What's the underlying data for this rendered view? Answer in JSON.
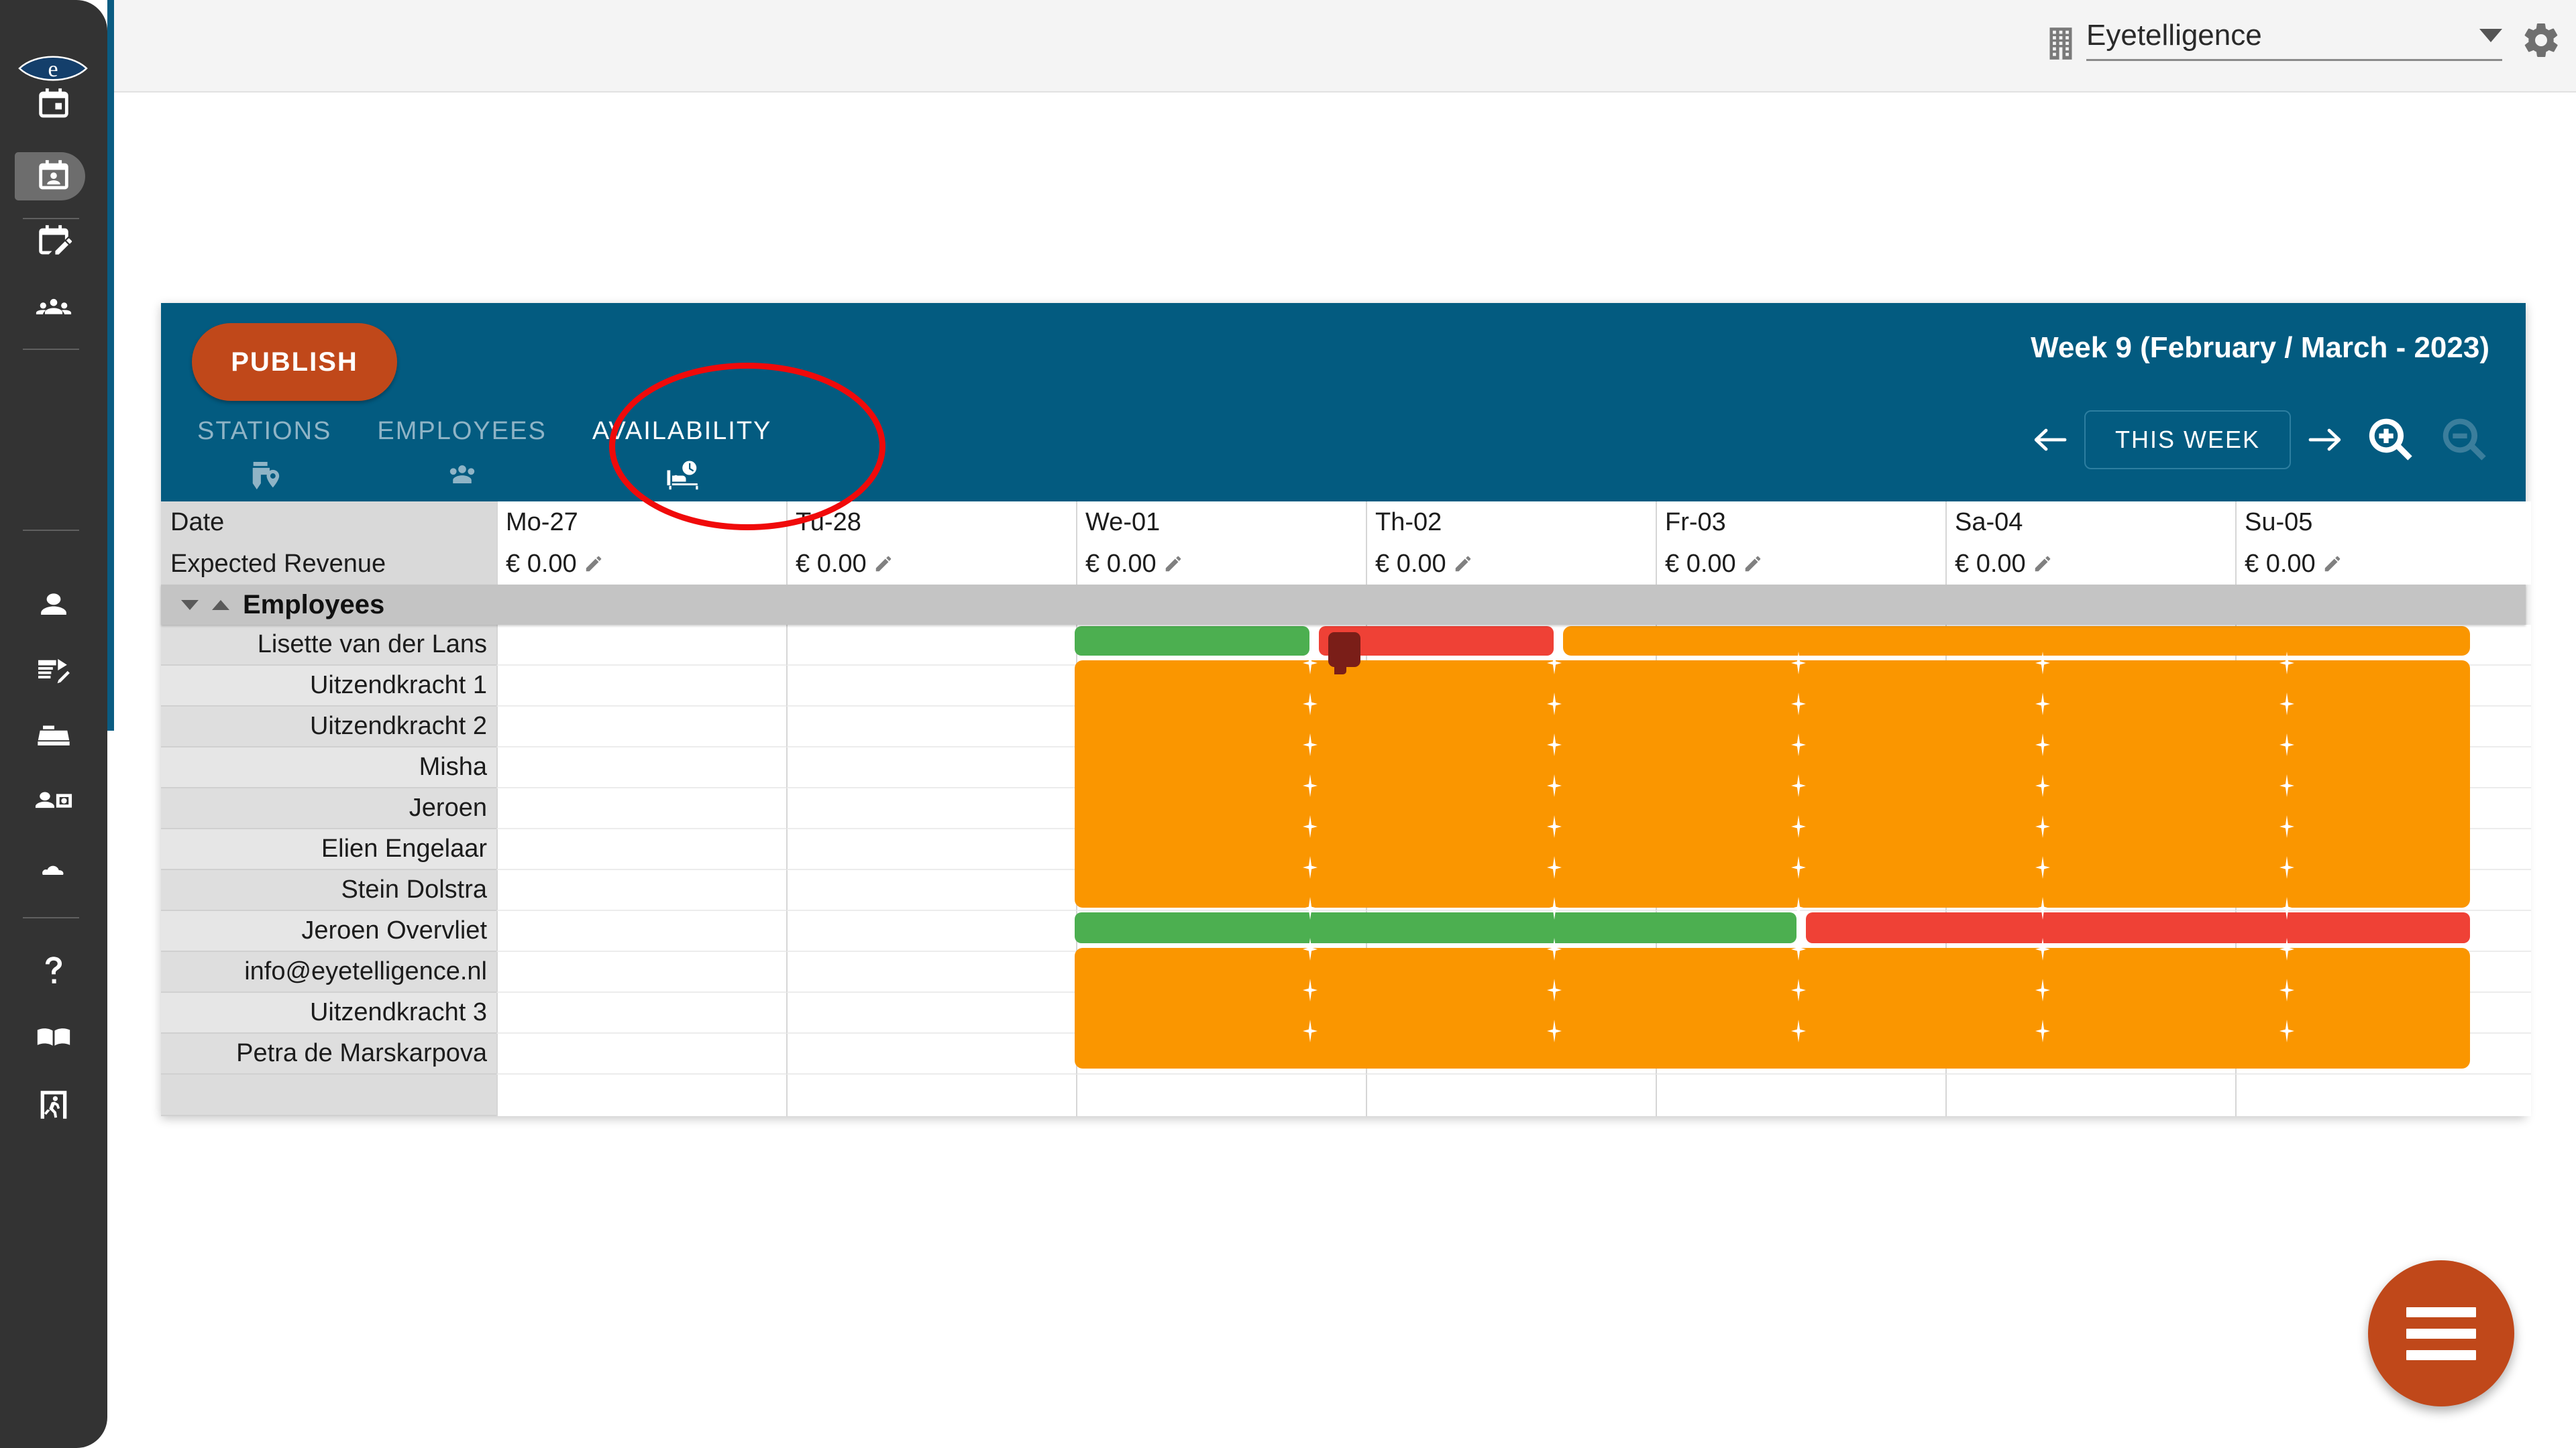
{
  "topbar": {
    "org_icon": "building-icon",
    "org_name": "Eyetelligence",
    "settings_icon": "gear-icon",
    "dropdown_icon": "chevron-down-icon"
  },
  "sidebar": {
    "logo": "eyetelligence-eye-logo",
    "items": [
      {
        "icon": "calendar-event-icon",
        "name": "sidebar-item-schedule"
      },
      {
        "icon": "calendar-person-icon",
        "name": "sidebar-item-availability",
        "active": true
      },
      {
        "icon": "calendar-edit-icon",
        "name": "sidebar-item-edit-schedule"
      },
      {
        "icon": "people-group-icon",
        "name": "sidebar-item-teams"
      },
      {
        "icon": "person-icon",
        "name": "sidebar-item-profile"
      },
      {
        "icon": "document-signature-icon",
        "name": "sidebar-item-contracts"
      },
      {
        "icon": "cash-register-icon",
        "name": "sidebar-item-register"
      },
      {
        "icon": "person-badge-icon",
        "name": "sidebar-item-employees"
      },
      {
        "icon": "cloud-icon",
        "name": "sidebar-item-cloud"
      },
      {
        "icon": "question-mark-icon",
        "name": "sidebar-item-help"
      },
      {
        "icon": "book-icon",
        "name": "sidebar-item-manual"
      },
      {
        "icon": "exit-door-icon",
        "name": "sidebar-item-logout"
      }
    ]
  },
  "card_header": {
    "publish_label": "PUBLISH",
    "tabs": [
      {
        "label": "STATIONS",
        "icon": "station-pin-icon",
        "active": false
      },
      {
        "label": "EMPLOYEES",
        "icon": "people-group-icon",
        "active": false
      },
      {
        "label": "AVAILABILITY",
        "icon": "bed-clock-icon",
        "active": true
      }
    ],
    "week_title": "Week 9 (February / March - 2023)",
    "prev_label": "previous-week-arrow",
    "this_week_label": "THIS WEEK",
    "next_label": "next-week-arrow",
    "zoom_in_icon": "zoom-in-icon",
    "zoom_out_icon": "zoom-out-icon"
  },
  "grid": {
    "date_row_label": "Date",
    "revenue_row_label": "Expected Revenue",
    "days": [
      "Mo-27",
      "Tu-28",
      "We-01",
      "Th-02",
      "Fr-03",
      "Sa-04",
      "Su-05"
    ],
    "revenues": [
      "€ 0.00",
      "€ 0.00",
      "€ 0.00",
      "€ 0.00",
      "€ 0.00",
      "€ 0.00",
      "€ 0.00"
    ],
    "group_label": "Employees",
    "employees": [
      "Lisette van der Lans",
      "Uitzendkracht 1",
      "Uitzendkracht 2",
      "Misha",
      "Jeroen",
      "Elien Engelaar",
      "Stein Dolstra",
      "Jeroen Overvliet",
      "info@eyetelligence.nl",
      "Uitzendkracht 3",
      "Petra de Marskarpova"
    ]
  },
  "availability": {
    "legend": {
      "available": "#4caf50",
      "unavailable": "#ef4136",
      "partial": "#fa9600"
    },
    "bars": [
      {
        "row": 0,
        "start_day": "We-01",
        "end_day": "We-01",
        "status": "available",
        "color": "#4caf50"
      },
      {
        "row": 0,
        "start_day": "Th-02",
        "end_day": "Th-02",
        "status": "unavailable",
        "color": "#ef4136",
        "has_comment": true
      },
      {
        "row": 0,
        "start_day": "Fr-03",
        "end_day": "Su-05",
        "status": "partial",
        "color": "#fa9600"
      },
      {
        "row": 1,
        "start_day": "We-01",
        "end_day": "Su-05",
        "status": "partial",
        "color": "#fa9600"
      },
      {
        "row": 2,
        "start_day": "We-01",
        "end_day": "Su-05",
        "status": "partial",
        "color": "#fa9600"
      },
      {
        "row": 3,
        "start_day": "We-01",
        "end_day": "Su-05",
        "status": "partial",
        "color": "#fa9600"
      },
      {
        "row": 4,
        "start_day": "We-01",
        "end_day": "Su-05",
        "status": "partial",
        "color": "#fa9600"
      },
      {
        "row": 5,
        "start_day": "We-01",
        "end_day": "Su-05",
        "status": "partial",
        "color": "#fa9600"
      },
      {
        "row": 6,
        "start_day": "We-01",
        "end_day": "Su-05",
        "status": "partial",
        "color": "#fa9600"
      },
      {
        "row": 7,
        "start_day": "We-01",
        "end_day": "Fr-03",
        "status": "available",
        "color": "#4caf50"
      },
      {
        "row": 7,
        "start_day": "Sa-04",
        "end_day": "Su-05",
        "status": "unavailable",
        "color": "#ef4136"
      },
      {
        "row": 8,
        "start_day": "We-01",
        "end_day": "Su-05",
        "status": "partial",
        "color": "#fa9600"
      },
      {
        "row": 9,
        "start_day": "We-01",
        "end_day": "Su-05",
        "status": "partial",
        "color": "#fa9600"
      },
      {
        "row": 10,
        "start_day": "We-01",
        "end_day": "Su-05",
        "status": "partial",
        "color": "#fa9600"
      }
    ]
  },
  "fab": {
    "icon": "hamburger-menu-icon",
    "color": "#c0481a"
  },
  "annotation": {
    "shape": "ellipse",
    "color": "#f00a0a",
    "targets": "AVAILABILITY tab"
  }
}
